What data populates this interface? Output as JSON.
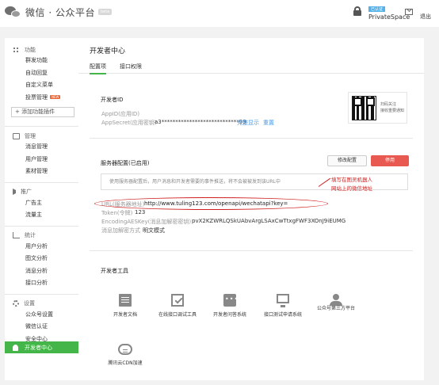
{
  "header": {
    "brand": "微信 · 公众平台",
    "brand_badge": "beta",
    "account_tag": "已认证",
    "account_name": "PrivateSpace",
    "logout_label": "退出"
  },
  "sidebar": {
    "groups": [
      {
        "title": "功能",
        "icon": "grid-icon",
        "items": [
          "群发功能",
          "自动回复",
          "自定义菜单",
          "投票管理"
        ],
        "new_badge": "NEW",
        "add_button": "+ 添加功能插件"
      },
      {
        "title": "管理",
        "icon": "manage-icon",
        "items": [
          "消息管理",
          "用户管理",
          "素材管理"
        ]
      },
      {
        "title": "推广",
        "icon": "horn-icon",
        "items": [
          "广告主",
          "流量主"
        ]
      },
      {
        "title": "统计",
        "icon": "chart-icon",
        "items": [
          "用户分析",
          "图文分析",
          "消息分析",
          "接口分析"
        ]
      },
      {
        "title": "设置",
        "icon": "gear-icon",
        "items": [
          "公众号设置",
          "微信认证",
          "安全中心"
        ]
      }
    ],
    "active": "开发者中心"
  },
  "main": {
    "title": "开发者中心",
    "tabs": [
      "配置项",
      "接口权限"
    ],
    "dev_id": {
      "title": "开发者ID",
      "appid_label": "AppID(应用ID)",
      "appid_value": "",
      "secret_label": "AppSecret(应用密钥)",
      "secret_value": "a3****************************99",
      "show_link": "完整显示",
      "reset_link": "重置"
    },
    "qr": {
      "line1": "扫码关注",
      "line2": "接收重要通知"
    },
    "server": {
      "title": "服务器配置(已启用)",
      "modify_button": "修改配置",
      "disable_button": "停用",
      "notice": "使用服务器配置后，用户消息和开发者需要的事件推送，将不会被被发到该URL中",
      "url_label": "URL(服务器地址)",
      "url_value": "http://www.tuling123.com/openapi/wechatapi?key=",
      "token_label": "Token(令牌)",
      "token_value": "123",
      "aes_label": "EncodingAESKey(消息加解密密钥)",
      "aes_value": "pvX2KZWRLQSkUAbvArgLSAxCwTtxgFWF3XOnJ9iEUMG",
      "mode_label": "消息加解密方式",
      "mode_value": "明文模式"
    },
    "annotation": {
      "line1": "填写在图灵机器人",
      "line2": "网站上的微信地址"
    },
    "tools": {
      "title": "开发者工具",
      "items": [
        {
          "label": "开发者文档",
          "icon": "document-icon"
        },
        {
          "label": "在线接口调试工具",
          "icon": "debug-icon"
        },
        {
          "label": "开发者问答系统",
          "icon": "chat-icon"
        },
        {
          "label": "接口测试申请系统",
          "icon": "monitor-icon"
        },
        {
          "label": "公众号第三方平台",
          "icon": "person-icon"
        },
        {
          "label": "腾讯云CDN加速",
          "icon": "cloud-icon"
        }
      ]
    }
  },
  "colors": {
    "accent": "#44b549",
    "danger": "#e85951",
    "link": "#459ae9",
    "annotation": "#d02020"
  }
}
